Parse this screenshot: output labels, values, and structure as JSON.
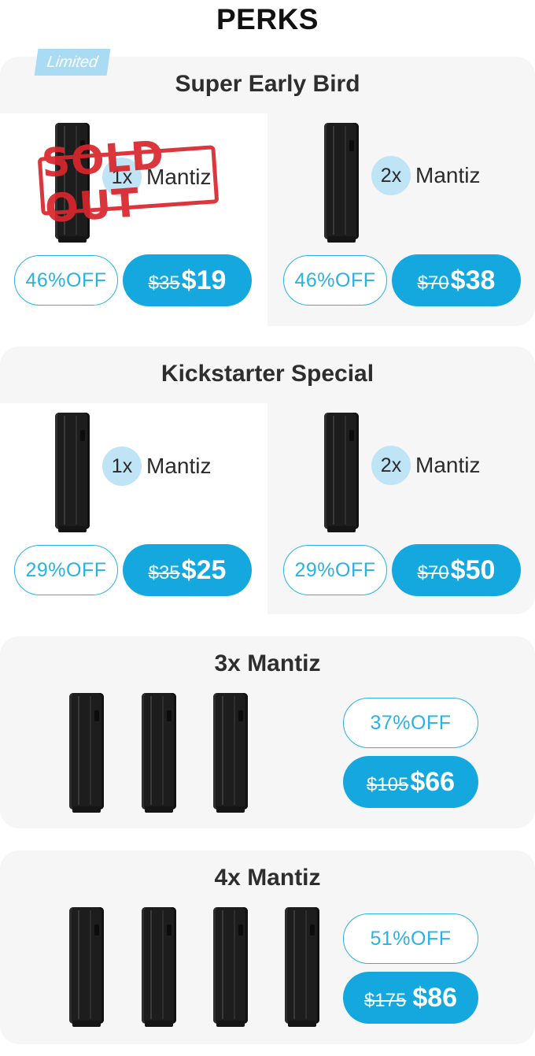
{
  "header": {
    "title": "PERKS"
  },
  "cards": [
    {
      "title": "Super Early Bird",
      "badge": "Limited",
      "sold_out_stamp": "SOLD OUT",
      "options": [
        {
          "qty": "1x",
          "name": "Mantiz",
          "off": "46%OFF",
          "old_price": "$35",
          "new_price": "$19",
          "sold_out": true
        },
        {
          "qty": "2x",
          "name": "Mantiz",
          "off": "46%OFF",
          "old_price": "$70",
          "new_price": "$38",
          "sold_out": false
        }
      ]
    },
    {
      "title": "Kickstarter Special",
      "options": [
        {
          "qty": "1x",
          "name": "Mantiz",
          "off": "29%OFF",
          "old_price": "$35",
          "new_price": "$25"
        },
        {
          "qty": "2x",
          "name": "Mantiz",
          "off": "29%OFF",
          "old_price": "$70",
          "new_price": "$50"
        }
      ]
    },
    {
      "title": "3x Mantiz",
      "off": "37%OFF",
      "old_price": "$105",
      "new_price": "$66"
    },
    {
      "title": "4x Mantiz",
      "off": "51%OFF",
      "old_price": "$175",
      "new_price": "$86"
    }
  ],
  "colors": {
    "accent": "#14a8df",
    "accent_light": "#bfe4f6",
    "card_bg": "#f6f6f6",
    "stamp": "#d9262c"
  }
}
